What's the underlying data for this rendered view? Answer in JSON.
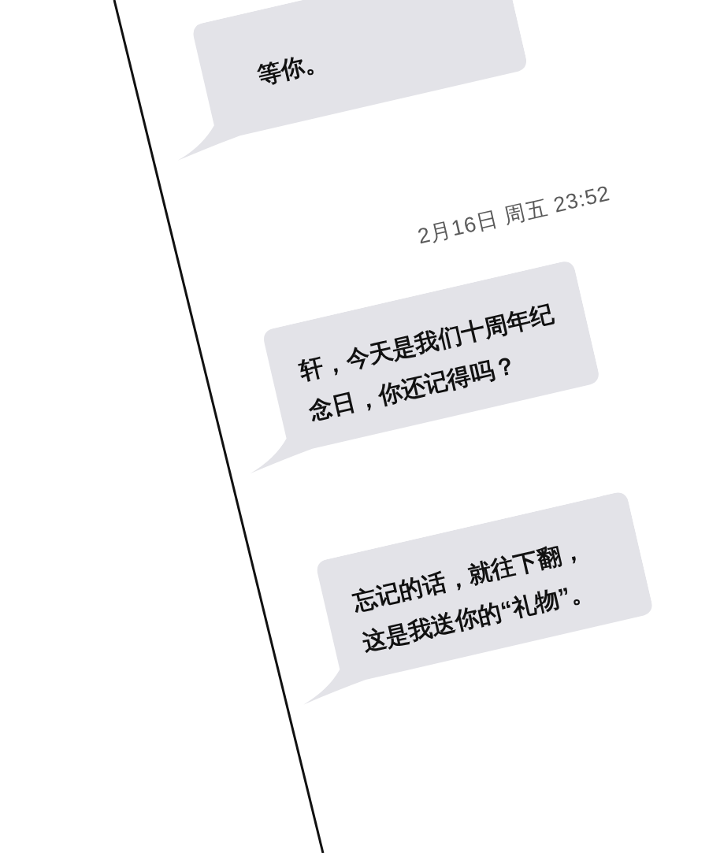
{
  "messages": [
    {
      "kind": "bubble",
      "lines": [
        "等你。"
      ]
    },
    {
      "kind": "timestamp",
      "text": "2月16日 周五 23:52"
    },
    {
      "kind": "bubble",
      "lines": [
        "轩，今天是我们十周年纪",
        "念日，你还记得吗？"
      ]
    },
    {
      "kind": "bubble",
      "lines": [
        "忘记的话，就往下翻，",
        "这是我送你的“礼物”。"
      ]
    }
  ]
}
